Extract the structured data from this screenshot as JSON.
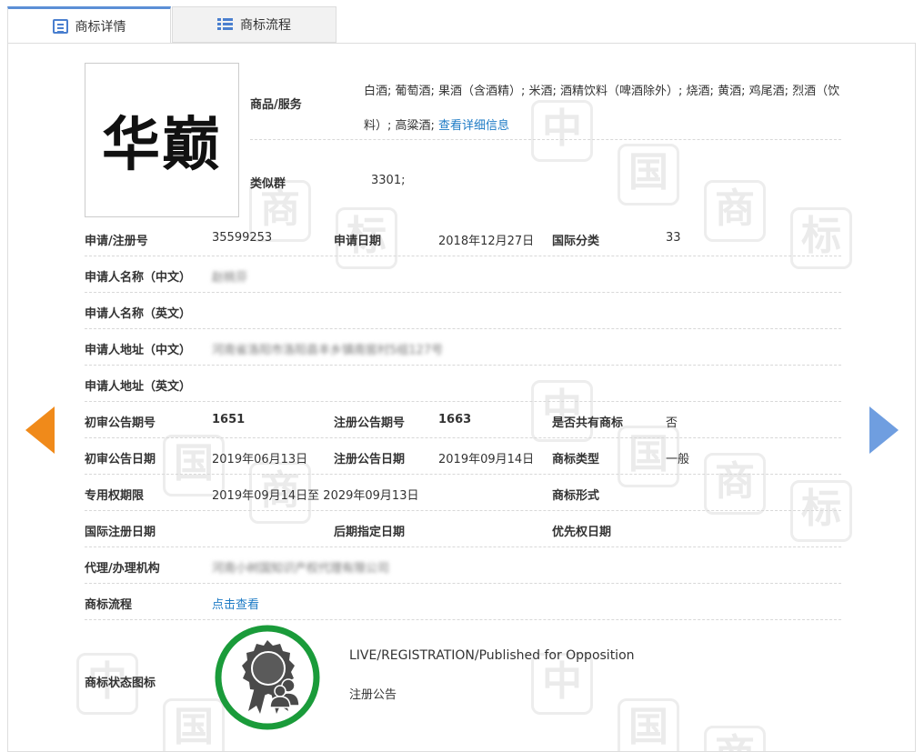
{
  "tabs": {
    "detail_label": "商标详情",
    "flow_label": "商标流程"
  },
  "watermark": {
    "chars": [
      "中",
      "国",
      "商",
      "标"
    ]
  },
  "logo": {
    "text": "华巅"
  },
  "goods": {
    "label": "商品/服务",
    "value": "白酒; 葡萄酒; 果酒（含酒精）; 米酒; 酒精饮料（啤酒除外）; 烧酒; 黄酒; 鸡尾酒; 烈酒（饮料）; 高粱酒;",
    "more_link": "查看详细信息"
  },
  "similar_group": {
    "label": "类似群",
    "value": "3301;"
  },
  "fields": {
    "reg_no_label": "申请/注册号",
    "reg_no": "35599253",
    "apply_date_label": "申请日期",
    "apply_date": "2018年12月27日",
    "intl_class_label": "国际分类",
    "intl_class": "33",
    "applicant_cn_label": "申请人名称（中文）",
    "applicant_cn": "赵桃芬",
    "applicant_en_label": "申请人名称（英文）",
    "address_cn_label": "申请人地址（中文）",
    "address_cn": "河南省洛阳市洛阳县丰乡镇南窖村5组127号",
    "address_en_label": "申请人地址（英文）",
    "prelim_no_label": "初审公告期号",
    "prelim_no": "1651",
    "reg_pub_no_label": "注册公告期号",
    "reg_pub_no": "1663",
    "shared_label": "是否共有商标",
    "shared": "否",
    "prelim_date_label": "初审公告日期",
    "prelim_date": "2019年06月13日",
    "reg_pub_date_label": "注册公告日期",
    "reg_pub_date": "2019年09月14日",
    "tm_type_label": "商标类型",
    "tm_type": "一般",
    "exclusive_label": "专用权期限",
    "exclusive": "2019年09月14日至 2029年09月13日",
    "tm_form_label": "商标形式",
    "intl_reg_date_label": "国际注册日期",
    "later_designation_label": "后期指定日期",
    "priority_date_label": "优先权日期",
    "agent_label": "代理/办理机构",
    "agent": "河南小树国知识产权代理有限公司",
    "flow_label": "商标流程",
    "flow_link": "点击查看",
    "status_label": "商标状态图标",
    "status_en": "LIVE/REGISTRATION/Published for Opposition",
    "status_cn": "注册公告"
  },
  "colors": {
    "accent_blue": "#4a7fcf",
    "link": "#1e7bc5",
    "arrow_left": "#f08a1a",
    "arrow_right": "#6f9ee0",
    "status_ring": "#1a9b3a"
  }
}
